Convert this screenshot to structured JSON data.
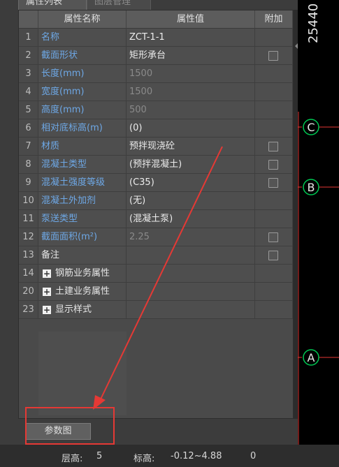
{
  "tabs": [
    {
      "label": "属性列表",
      "active": true
    },
    {
      "label": "图层管理",
      "active": false
    }
  ],
  "table": {
    "headers": {
      "name": "属性名称",
      "value": "属性值",
      "addon": "附加"
    },
    "rows": [
      {
        "num": "1",
        "name": "名称",
        "value": "ZCT-1-1",
        "name_color": "blue",
        "value_color": "white",
        "checkbox": false,
        "expander": false
      },
      {
        "num": "2",
        "name": "截面形状",
        "value": "矩形承台",
        "name_color": "blue",
        "value_color": "white",
        "checkbox": true,
        "expander": false
      },
      {
        "num": "3",
        "name": "长度(mm)",
        "value": "1500",
        "name_color": "blue",
        "value_color": "gray",
        "checkbox": false,
        "expander": false
      },
      {
        "num": "4",
        "name": "宽度(mm)",
        "value": "1500",
        "name_color": "blue",
        "value_color": "gray",
        "checkbox": false,
        "expander": false
      },
      {
        "num": "5",
        "name": "高度(mm)",
        "value": "500",
        "name_color": "blue",
        "value_color": "gray",
        "checkbox": false,
        "expander": false
      },
      {
        "num": "6",
        "name": "相对底标高(m)",
        "value": "(0)",
        "name_color": "blue",
        "value_color": "white",
        "checkbox": false,
        "expander": false
      },
      {
        "num": "7",
        "name": "材质",
        "value": "预拌现浇砼",
        "name_color": "blue",
        "value_color": "white",
        "checkbox": true,
        "expander": false
      },
      {
        "num": "8",
        "name": "混凝土类型",
        "value": "(预拌混凝土)",
        "name_color": "blue",
        "value_color": "white",
        "checkbox": true,
        "expander": false
      },
      {
        "num": "9",
        "name": "混凝土强度等级",
        "value": "(C35)",
        "name_color": "blue",
        "value_color": "white",
        "checkbox": true,
        "expander": false
      },
      {
        "num": "10",
        "name": "混凝土外加剂",
        "value": "(无)",
        "name_color": "blue",
        "value_color": "white",
        "checkbox": false,
        "expander": false
      },
      {
        "num": "11",
        "name": "泵送类型",
        "value": "(混凝土泵)",
        "name_color": "blue",
        "value_color": "white",
        "checkbox": false,
        "expander": false
      },
      {
        "num": "12",
        "name": "截面面积(m²)",
        "value": "2.25",
        "name_color": "blue",
        "value_color": "gray",
        "checkbox": true,
        "expander": false
      },
      {
        "num": "13",
        "name": "备注",
        "value": "",
        "name_color": "white",
        "value_color": "white",
        "checkbox": true,
        "expander": false
      },
      {
        "num": "14",
        "name": "钢筋业务属性",
        "value": "",
        "name_color": "white",
        "value_color": "white",
        "checkbox": false,
        "expander": true
      },
      {
        "num": "20",
        "name": "土建业务属性",
        "value": "",
        "name_color": "white",
        "value_color": "white",
        "checkbox": false,
        "expander": true
      },
      {
        "num": "23",
        "name": "显示样式",
        "value": "",
        "name_color": "white",
        "value_color": "white",
        "checkbox": false,
        "expander": true
      }
    ]
  },
  "param_button": {
    "label": "参数图"
  },
  "cad": {
    "dimension_text": "25440",
    "axis_labels": [
      "C",
      "B",
      "A"
    ],
    "axis_color": "#00c853",
    "grid_color": "#e53935"
  },
  "status_bar": {
    "floor_label": "层高:",
    "floor_value": "5",
    "elev_label": "标高:",
    "elev_value": "-0.12~4.88",
    "extra_value": "0"
  },
  "colors": {
    "name_blue": "#6ea8e6",
    "annotation_red": "#e53935"
  }
}
